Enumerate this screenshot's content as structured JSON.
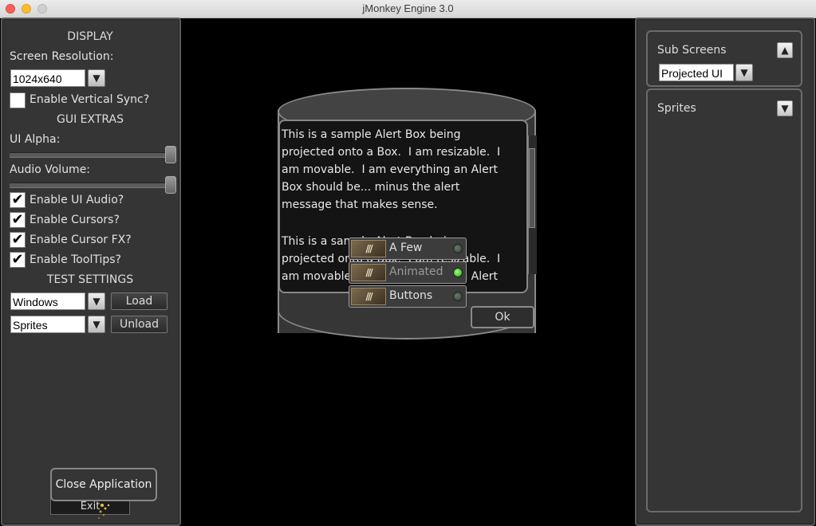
{
  "window": {
    "title": "jMonkey Engine 3.0"
  },
  "left_panel": {
    "display_header": "DISPLAY",
    "screen_resolution_label": "Screen Resolution:",
    "resolution_value": "1024x640",
    "vsync_label": "Enable Vertical Sync?",
    "gui_extras_header": "GUI EXTRAS",
    "ui_alpha_label": "UI Alpha:",
    "ui_alpha_level": 1.0,
    "audio_volume_label": "Audio Volume:",
    "audio_volume_level": 1.0,
    "checkboxes": [
      {
        "label": "Enable UI Audio?",
        "checked": true
      },
      {
        "label": "Enable Cursors?",
        "checked": true
      },
      {
        "label": "Enable Cursor FX?",
        "checked": true
      },
      {
        "label": "Enable ToolTips?",
        "checked": true
      }
    ],
    "check_glyph": "✔",
    "test_settings_header": "TEST SETTINGS",
    "test_select_1": "Windows",
    "load_button": "Load",
    "test_select_2": "Sprites",
    "unload_button": "Unload",
    "close_app_button": "Close Application",
    "exit_button": "Exit"
  },
  "right_panel": {
    "sub_screens_title": "Sub Screens",
    "sub_screens_select": "Projected UI",
    "sprites_title": "Sprites"
  },
  "scene": {
    "alert_lines_1": [
      "This is a sample Alert Box being",
      "projected onto a Box.  I am resizable.  I",
      "am movable.  I am everything an Alert",
      "Box should be... minus the alert",
      "message that makes sense."
    ],
    "alert_lines_2": [
      "This is a sample Alert Box being",
      "projected onto a Box.  I am resizable.  I",
      "am movable.  I am everything an Alert"
    ],
    "ok_button": "Ok",
    "anim_buttons": [
      {
        "label": "A Few",
        "led": "off"
      },
      {
        "label": "Animated",
        "led": "on"
      },
      {
        "label": "Buttons",
        "led": "off"
      }
    ]
  },
  "icons": {
    "dropdown": "chevron-down-icon",
    "collapse": "chevron-up-icon",
    "expand": "chevron-down-icon"
  }
}
